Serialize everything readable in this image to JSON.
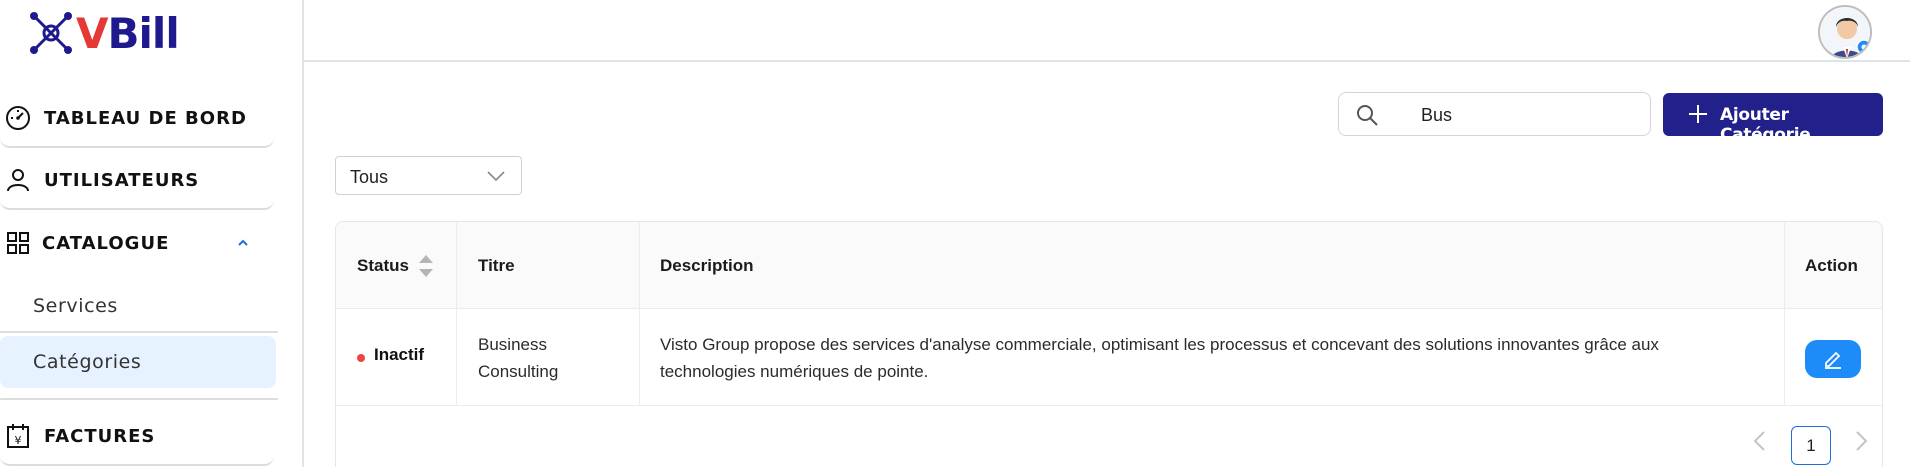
{
  "brand": {
    "logo_v": "V",
    "logo_rest": "Bill"
  },
  "sidebar": {
    "items": [
      {
        "label": "TABLEAU DE BORD",
        "icon": "dashboard-gauge-icon"
      },
      {
        "label": "UTILISATEURS",
        "icon": "user-icon"
      },
      {
        "label": "CATALOGUE",
        "icon": "grid-icon",
        "expanded": true
      },
      {
        "label": "FACTURES",
        "icon": "invoice-calendar-icon"
      }
    ],
    "catalogue_sub": [
      {
        "label": "Services",
        "active": false
      },
      {
        "label": "Catégories",
        "active": true
      }
    ]
  },
  "toolbar": {
    "search_value": "Bus",
    "add_label": "Ajouter Catégorie",
    "filter_value": "Tous"
  },
  "table": {
    "columns": [
      "Status",
      "Titre",
      "Description",
      "Action"
    ],
    "rows": [
      {
        "status": "Inactif",
        "title_line1": "Business",
        "title_line2": "Consulting",
        "desc_line1": "Visto Group propose des services d'analyse commerciale, optimisant les processus et concevant des solutions innovantes grâce aux",
        "desc_line2": "technologies numériques de pointe."
      }
    ]
  },
  "pagination": {
    "current_page": "1"
  },
  "colors": {
    "primary": "#22218b",
    "accent": "#1d8cf8",
    "inactive": "#ef4444",
    "active_sub_bg": "#e6f2ff"
  }
}
